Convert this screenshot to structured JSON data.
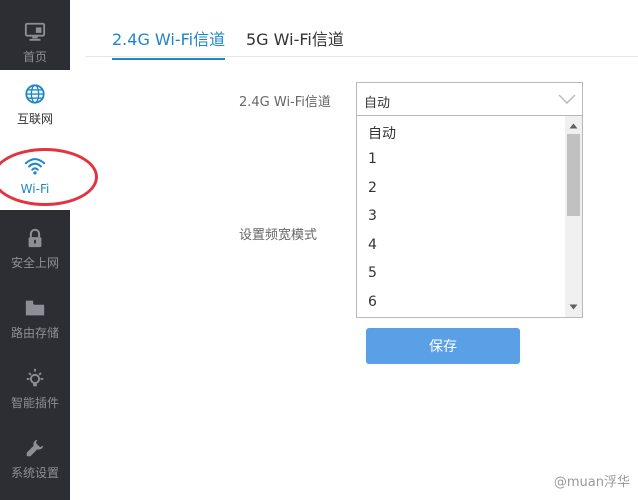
{
  "sidebar": {
    "items": [
      {
        "label": "首页",
        "icon": "monitor-icon"
      },
      {
        "label": "互联网",
        "icon": "globe-icon"
      },
      {
        "label": "Wi-Fi",
        "icon": "wifi-icon"
      },
      {
        "label": "安全上网",
        "icon": "lock-icon"
      },
      {
        "label": "路由存储",
        "icon": "folder-icon"
      },
      {
        "label": "智能插件",
        "icon": "bulb-icon"
      },
      {
        "label": "系统设置",
        "icon": "wrench-icon"
      }
    ]
  },
  "tabs": [
    {
      "label": "2.4G Wi-Fi信道",
      "active": true
    },
    {
      "label": "5G Wi-Fi信道",
      "active": false
    }
  ],
  "form": {
    "channel_label": "2.4G Wi-Fi信道",
    "channel_selected": "自动",
    "channel_options": [
      "自动",
      "1",
      "2",
      "3",
      "4",
      "5",
      "6"
    ],
    "bandwidth_label": "设置频宽模式",
    "save_label": "保存"
  },
  "watermark": "@muan浮华",
  "colors": {
    "accent": "#1e86c8",
    "sidebar_bg": "#2c2e33",
    "button": "#5aa0e6",
    "annotation": "#e2343e"
  }
}
